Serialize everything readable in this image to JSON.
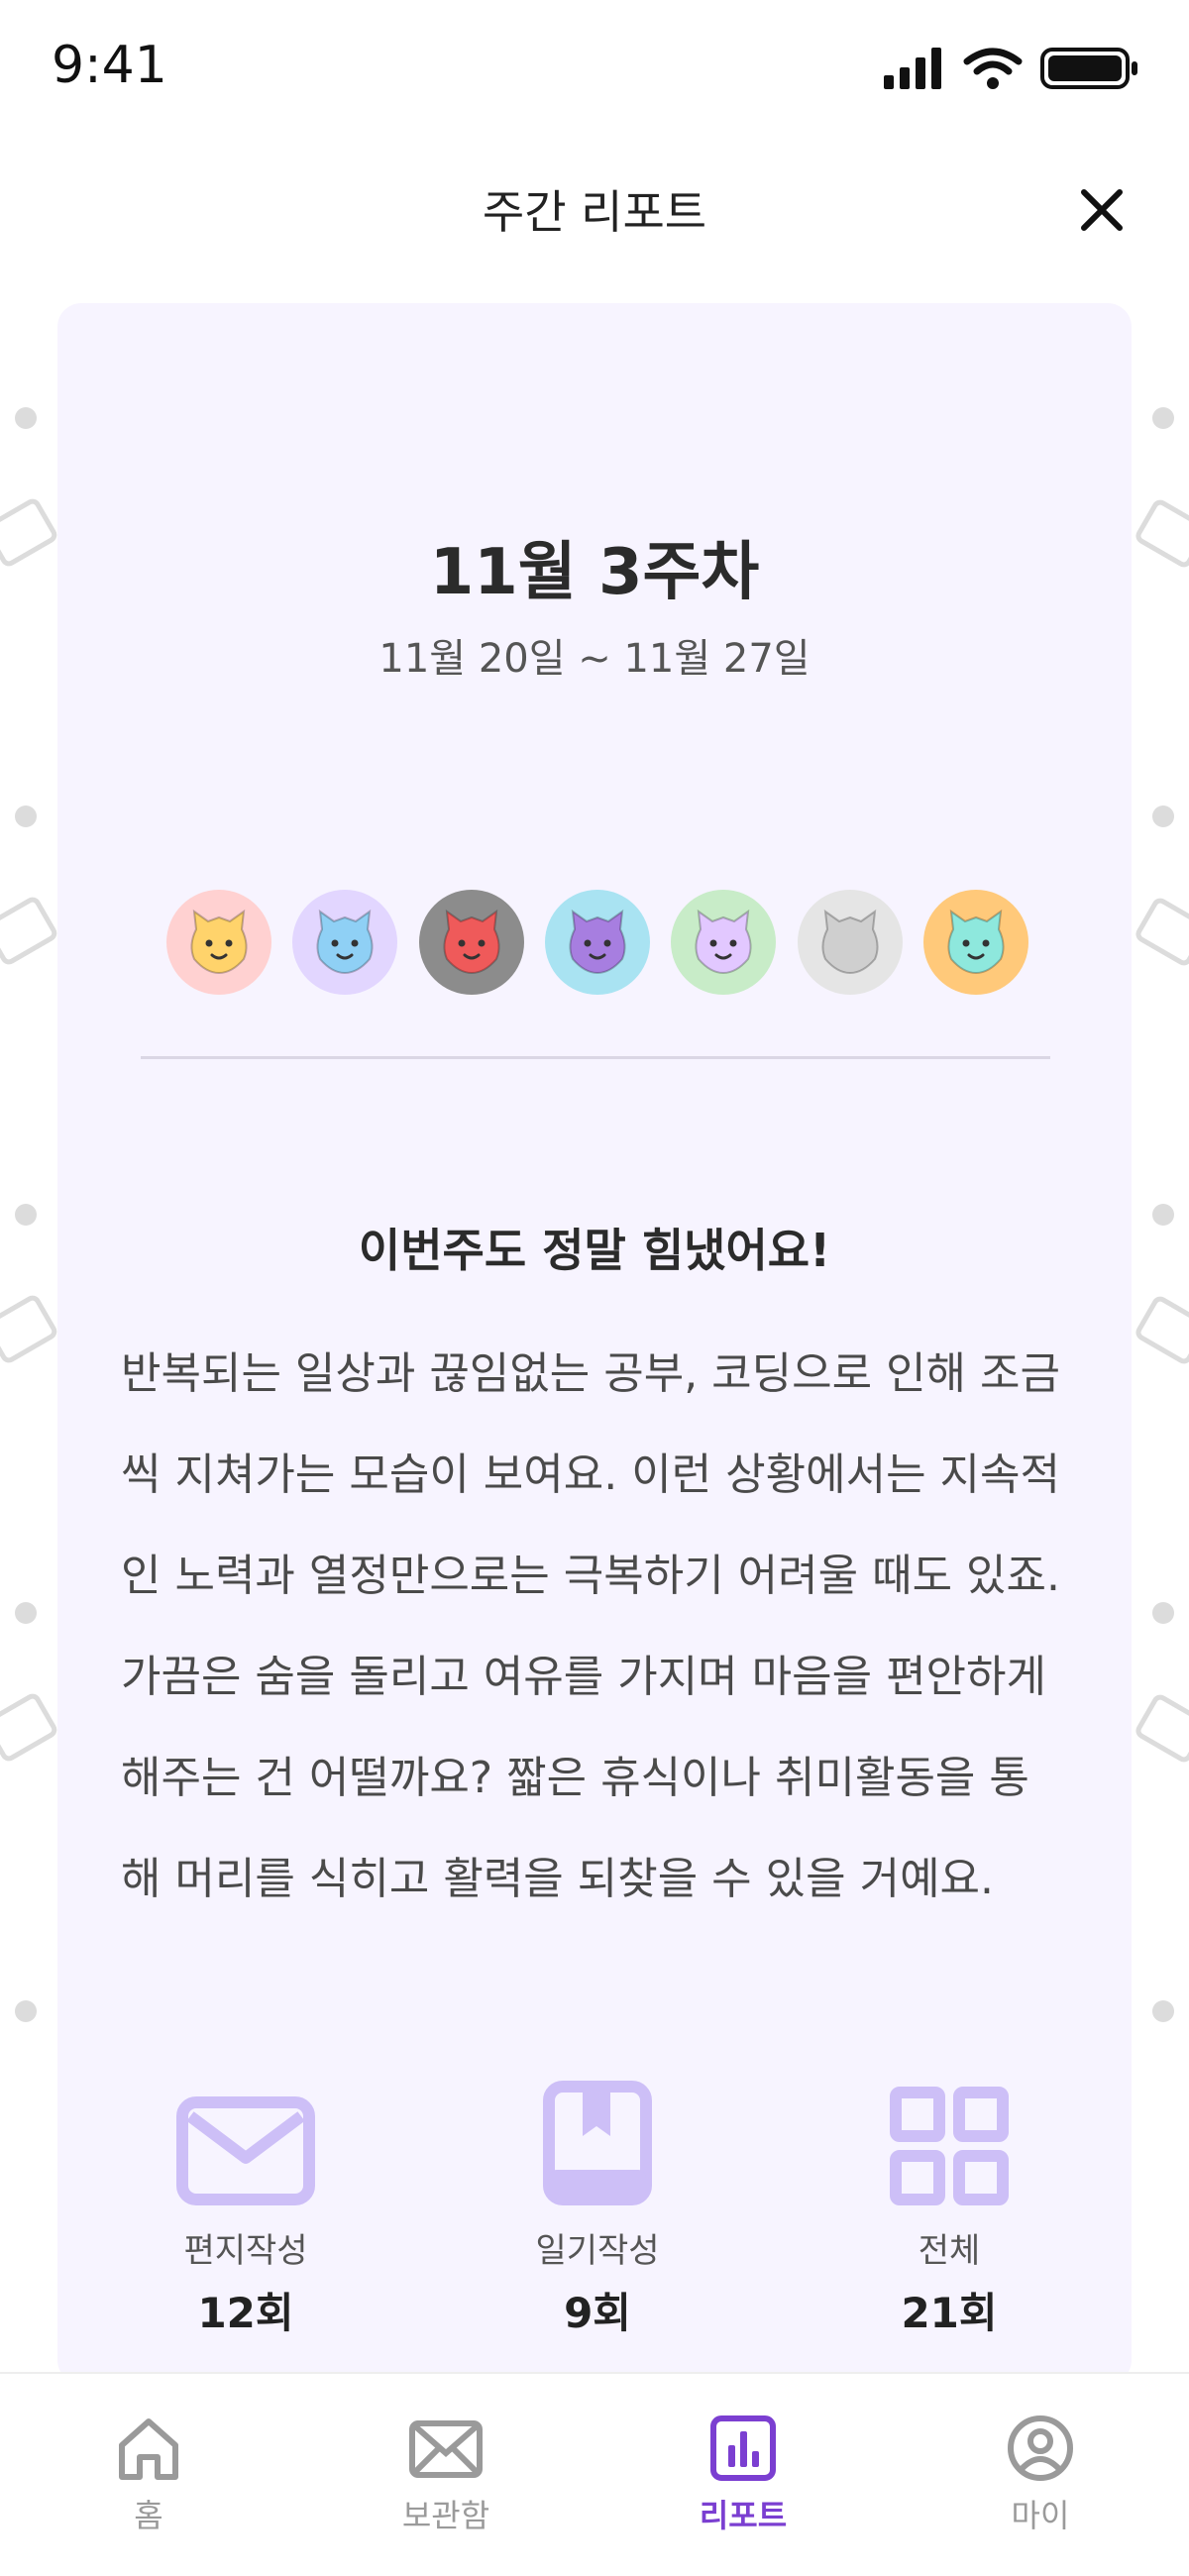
{
  "status_bar": {
    "time": "9:41"
  },
  "header": {
    "title": "주간 리포트"
  },
  "report": {
    "week_title": "11월 3주차",
    "date_range": "11월 20일 ~ 11월 27일",
    "emotions": [
      {
        "name": "happy",
        "bg": "#ffd1d1",
        "face": "#ffd36b"
      },
      {
        "name": "sad",
        "bg": "#e2d6ff",
        "face": "#8fd0f5"
      },
      {
        "name": "angry",
        "bg": "#8c8c8c",
        "face": "#ef5a5a"
      },
      {
        "name": "surprised",
        "bg": "#a9e3f2",
        "face": "#a77ee0"
      },
      {
        "name": "confused",
        "bg": "#c8ecc8",
        "face": "#e2c8ff"
      },
      {
        "name": "empty",
        "bg": "#e5e5e5",
        "face": "#cfcfcf"
      },
      {
        "name": "calm",
        "bg": "#ffc97a",
        "face": "#8ee8dd"
      }
    ],
    "message_title": "이번주도 정말 힘냈어요!",
    "message_lines": [
      "반복되는 일상과 끊임없는 공부, 코딩으로 인해 조금",
      "씩 지쳐가는 모습이 보여요. 이런 상황에서는 지속적",
      "인 노력과 열정만으로는 극복하기 어려울 때도 있죠.",
      "가끔은 숨을 돌리고 여유를 가지며 마음을 편안하게",
      "해주는 건 어떨까요? 짧은 휴식이나 취미활동을 통",
      "해 머리를 식히고 활력을 되찾을 수 있을 거예요."
    ],
    "stats": [
      {
        "icon": "envelope-icon",
        "label": "편지작성",
        "count": "12회"
      },
      {
        "icon": "book-icon",
        "label": "일기작성",
        "count": "9회"
      },
      {
        "icon": "grid-icon",
        "label": "전체",
        "count": "21회"
      }
    ]
  },
  "tabs": [
    {
      "icon": "home-icon",
      "label": "홈",
      "active": false
    },
    {
      "icon": "mailbox-icon",
      "label": "보관함",
      "active": false
    },
    {
      "icon": "report-icon",
      "label": "리포트",
      "active": true
    },
    {
      "icon": "profile-icon",
      "label": "마이",
      "active": false
    }
  ],
  "colors": {
    "accent": "#7b3fd1",
    "card_bg": "#f7f4ff",
    "stat_icon": "#cdbff7"
  }
}
